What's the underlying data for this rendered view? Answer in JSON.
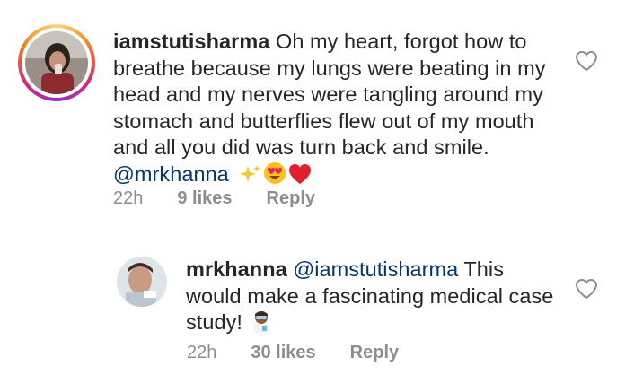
{
  "comments": [
    {
      "username": "iamstutisharma",
      "text": "Oh my heart, forgot how to breathe because my lungs were beating in my head and my nerves were tangling around my stomach and butterflies flew out of my mouth and all you did was turn back and smile.",
      "mention": "@mrkhanna",
      "time": "22h",
      "likes": "9 likes",
      "reply": "Reply",
      "icons": [
        "sparkles-emoji",
        "heart-eyes-emoji",
        "red-heart-emoji"
      ]
    },
    {
      "username": "mrkhanna",
      "mention": "@iamstutisharma",
      "text": "This would make a fascinating medical case study!",
      "time": "22h",
      "likes": "30 likes",
      "reply": "Reply",
      "icons": [
        "scientist-emoji"
      ]
    }
  ],
  "colors": {
    "text": "#262626",
    "mention": "#00376b",
    "meta": "#8e8e8e"
  }
}
